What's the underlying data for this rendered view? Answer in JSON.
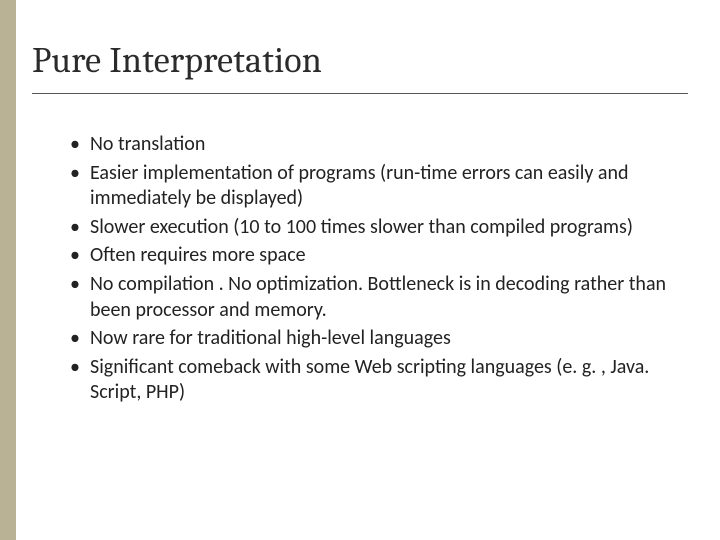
{
  "slide": {
    "title": "Pure Interpretation",
    "bullets": [
      "No translation",
      "Easier implementation of programs (run-time errors can easily and immediately be displayed)",
      "Slower execution (10 to 100 times slower than compiled programs)",
      "Often requires more space",
      "No compilation .  No optimization.  Bottleneck is in decoding rather than been processor and memory.",
      "Now rare for traditional high-level languages",
      "Significant comeback with some Web scripting languages (e. g. , Java. Script, PHP)"
    ],
    "accent_color": "#b9b294"
  }
}
